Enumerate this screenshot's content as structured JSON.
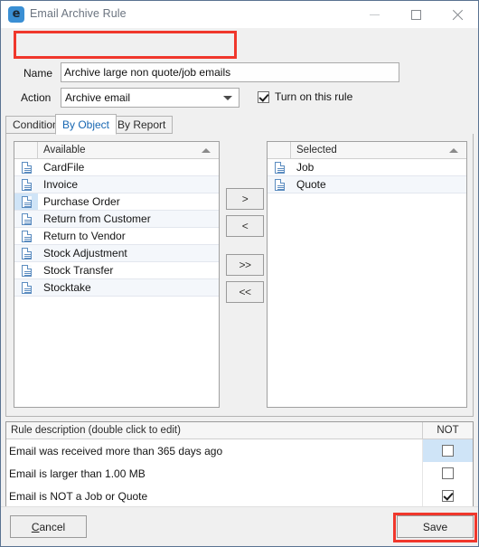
{
  "window": {
    "title": "Email Archive Rule",
    "app_icon": "email-rule-icon",
    "icon_glyph": "€",
    "accent_color": "#3a8fd4",
    "annotation_color": "#f0372c",
    "controls": {
      "minimize": "minimize-icon",
      "maximize": "maximize-icon",
      "close": "close-icon"
    }
  },
  "form": {
    "name_label": "Name",
    "name_value": "Archive large non quote/job emails",
    "name_placeholder": "",
    "action_label": "Action",
    "action_value": "Archive email",
    "action_options": [
      "Archive email"
    ],
    "turn_on_label": "Turn on this rule",
    "turn_on_checked": true
  },
  "tabs": [
    {
      "label": "Conditions",
      "active": false
    },
    {
      "label": "By Object",
      "active": true
    },
    {
      "label": "By Report",
      "active": false
    }
  ],
  "available": {
    "header": "Available",
    "sort": "ascending",
    "items": [
      {
        "label": "CardFile",
        "selected": false
      },
      {
        "label": "Invoice",
        "selected": false
      },
      {
        "label": "Purchase Order",
        "selected": true
      },
      {
        "label": "Return from Customer",
        "selected": false
      },
      {
        "label": "Return to Vendor",
        "selected": false
      },
      {
        "label": "Stock Adjustment",
        "selected": false
      },
      {
        "label": "Stock Transfer",
        "selected": false
      },
      {
        "label": "Stocktake",
        "selected": false
      }
    ]
  },
  "selected": {
    "header": "Selected",
    "sort": "ascending",
    "items": [
      {
        "label": "Job",
        "selected": false
      },
      {
        "label": "Quote",
        "selected": false
      }
    ]
  },
  "transfer_buttons": [
    {
      "label": ">",
      "name": "move-right-button"
    },
    {
      "label": "<",
      "name": "move-left-button"
    },
    {
      "label": ">>",
      "name": "move-all-right-button"
    },
    {
      "label": "<<",
      "name": "move-all-left-button"
    }
  ],
  "rule_description": {
    "header_desc": "Rule description (double click to edit)",
    "header_not": "NOT",
    "rows": [
      {
        "text": "Email was received more than 365 days ago",
        "not": false,
        "selected": true
      },
      {
        "text": "Email is larger than 1.00 MB",
        "not": false,
        "selected": false
      },
      {
        "text": "Email is NOT a Job or Quote",
        "not": true,
        "selected": false
      }
    ]
  },
  "footer": {
    "cancel_accel": "C",
    "cancel_rest": "ancel",
    "save_label": "Save"
  }
}
